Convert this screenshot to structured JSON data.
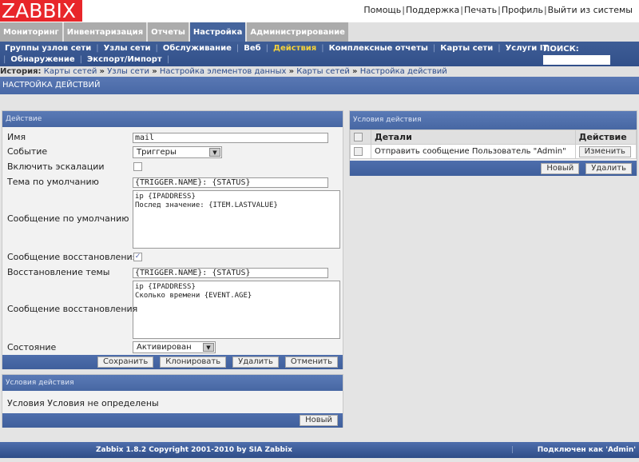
{
  "logo": "ZABBIX",
  "toplinks": [
    "Помощь",
    "Поддержка",
    "Печать",
    "Профиль",
    "Выйти из системы"
  ],
  "mainmenu": [
    "Мониторинг",
    "Инвентаризация",
    "Отчеты",
    "Настройка",
    "Администрирование"
  ],
  "submenu": {
    "row1": [
      "Группы узлов сети",
      "Узлы сети",
      "Обслуживание",
      "Веб",
      "Действия",
      "Комплексные отчеты",
      "Карты сети",
      "Услуги IT"
    ],
    "row2": [
      "Обнаружение",
      "Экспорт/Импорт"
    ],
    "search_label": "ПОИСК:",
    "search_value": ""
  },
  "history": {
    "label": "История:",
    "items": [
      "Карты сетей",
      "Узлы сети",
      "Настройка элементов данных",
      "Карты сетей",
      "Настройка действий"
    ]
  },
  "page_title": "НАСТРОЙКА ДЕЙСТВИЙ",
  "action_form": {
    "title": "Действие",
    "name_label": "Имя",
    "name_value": "mail",
    "event_label": "Событие",
    "event_value": "Триггеры",
    "escalation_label": "Включить эскалации",
    "escalation_checked": false,
    "subject_label": "Тема по умолчанию",
    "subject_value": "{TRIGGER.NAME}: {STATUS}",
    "message_label": "Сообщение по умолчанию",
    "message_value": "ip {IPADDRESS}\nПослед значение: {ITEM.LASTVALUE}",
    "recovery_label": "Сообщение восстановления",
    "recovery_checked": true,
    "recovery_subject_label": "Восстановление темы",
    "recovery_subject_value": "{TRIGGER.NAME}: {STATUS}",
    "recovery_message_label": "Сообщение восстановления",
    "recovery_message_value": "ip {IPADDRESS}\nСколько времени {EVENT.AGE}",
    "status_label": "Состояние",
    "status_value": "Активирован",
    "buttons": {
      "save": "Сохранить",
      "clone": "Клонировать",
      "delete": "Удалить",
      "cancel": "Отменить"
    }
  },
  "conditions": {
    "title": "Условия действия",
    "label": "Условия",
    "value": "Условия не определены",
    "new": "Новый"
  },
  "operations": {
    "title": "Условия действия",
    "col_details": "Детали",
    "col_action": "Действие",
    "rows": [
      {
        "details": "Отправить сообщение Пользователь \"Admin\"",
        "edit": "Изменить"
      }
    ],
    "new": "Новый",
    "delete": "Удалить"
  },
  "footer": {
    "copyright": "Zabbix 1.8.2 Copyright 2001-2010 by SIA Zabbix",
    "connected": "Подключен как 'Admin'"
  }
}
